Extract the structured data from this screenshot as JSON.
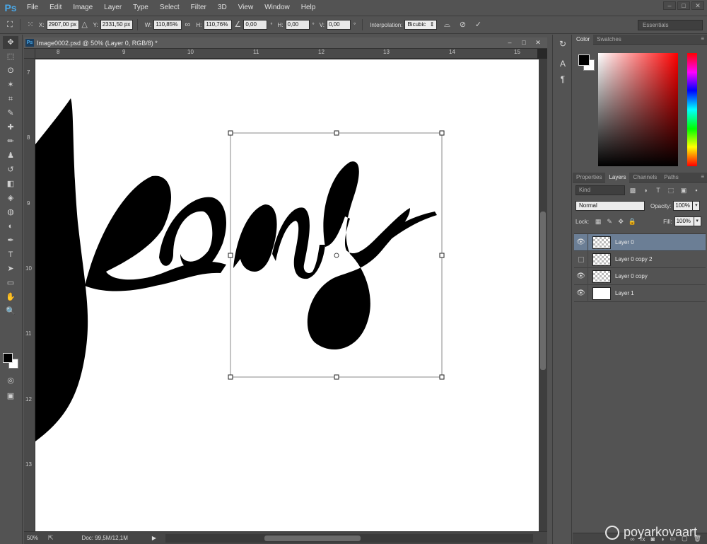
{
  "app": {
    "logo": "Ps"
  },
  "menu": [
    "File",
    "Edit",
    "Image",
    "Layer",
    "Type",
    "Select",
    "Filter",
    "3D",
    "View",
    "Window",
    "Help"
  ],
  "window_controls": {
    "minimize": "–",
    "maximize": "□",
    "close": "✕"
  },
  "options": {
    "x_label": "X:",
    "x_value": "2907,00 px",
    "y_label": "Y:",
    "y_value": "2331,50 px",
    "w_label": "W:",
    "w_value": "110,85%",
    "h_label": "H:",
    "h_value": "110,76%",
    "angle_value": "0,00",
    "angle_unit": "°",
    "hskew_label": "H:",
    "hskew_value": "0,00",
    "hskew_unit": "°",
    "vskew_label": "V:",
    "vskew_value": "0,00",
    "vskew_unit": "°",
    "interp_label": "Interpolation:",
    "interp_value": "Bicubic",
    "cancel_icon": "⊘",
    "commit_icon": "✓",
    "workspace": "Essentials"
  },
  "tools": [
    "move-icon",
    "marquee-icon",
    "lasso-icon",
    "magic-wand-icon",
    "crop-icon",
    "eyedropper-icon",
    "healing-icon",
    "brush-icon",
    "stamp-icon",
    "history-brush-icon",
    "eraser-icon",
    "bucket-icon",
    "blur-icon",
    "dodge-icon",
    "pen-icon",
    "type-icon",
    "path-select-icon",
    "rectangle-icon",
    "hand-icon",
    "zoom-icon"
  ],
  "tool_glyphs": [
    "✥",
    "⬚",
    "ʘ",
    "✶",
    "⌗",
    "✎",
    "✚",
    "✏",
    "♟",
    "↺",
    "◧",
    "◈",
    "◍",
    "◐",
    "✒",
    "T",
    "➤",
    "▭",
    "✋",
    "🔍"
  ],
  "document": {
    "title": "Image0002.psd @ 50% (Layer 0, RGB/8) *",
    "ruler_top": [
      "8",
      "9",
      "10",
      "11",
      "12",
      "13",
      "14",
      "15"
    ],
    "ruler_left": [
      "7",
      "8",
      "9",
      "10",
      "11",
      "12",
      "13"
    ],
    "zoom": "50%",
    "doc_info": "Doc: 99,5M/12,1M",
    "canvas_text": "Jeans"
  },
  "color_panel": {
    "tabs": [
      "Color",
      "Swatches"
    ],
    "fg": "#000000",
    "bg": "#ffffff"
  },
  "layers_panel": {
    "tabs": [
      "Properties",
      "Layers",
      "Channels",
      "Paths"
    ],
    "kind": "Kind",
    "blend_mode": "Normal",
    "opacity_label": "Opacity:",
    "opacity": "100%",
    "lock_label": "Lock:",
    "fill_label": "Fill:",
    "fill": "100%",
    "layers": [
      {
        "name": "Layer 0",
        "visible": true,
        "selected": true,
        "thumb": "transparent"
      },
      {
        "name": "Layer 0 copy 2",
        "visible": false,
        "selected": false,
        "thumb": "transparent"
      },
      {
        "name": "Layer 0 copy",
        "visible": true,
        "selected": false,
        "thumb": "transparent"
      },
      {
        "name": "Layer 1",
        "visible": true,
        "selected": false,
        "thumb": "white"
      }
    ]
  },
  "watermark": "poyarkovaart"
}
